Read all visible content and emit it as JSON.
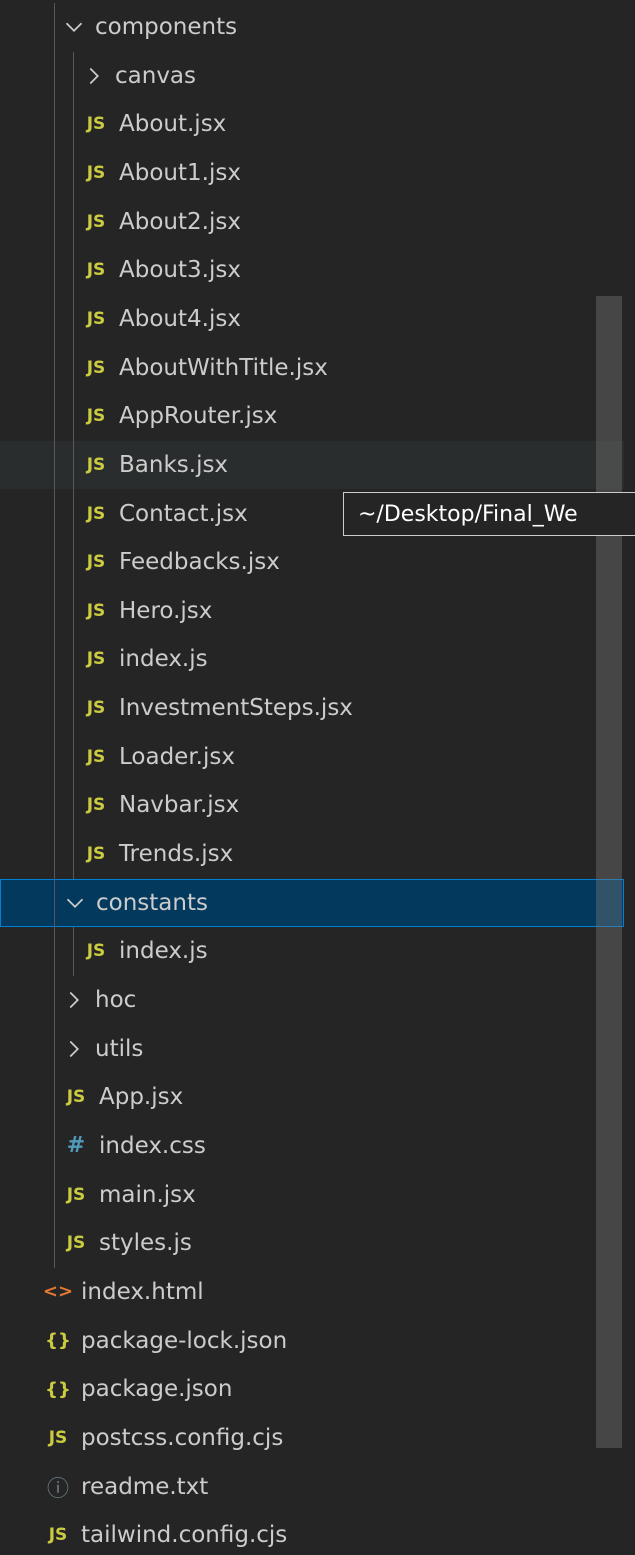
{
  "tooltip": {
    "text": "~/Desktop/Final_We"
  },
  "items": [
    {
      "label": "components",
      "kind": "folder-open",
      "depth": 1
    },
    {
      "label": "canvas",
      "kind": "folder-closed",
      "depth": 2
    },
    {
      "label": "About.jsx",
      "kind": "js",
      "depth": 2
    },
    {
      "label": "About1.jsx",
      "kind": "js",
      "depth": 2
    },
    {
      "label": "About2.jsx",
      "kind": "js",
      "depth": 2
    },
    {
      "label": "About3.jsx",
      "kind": "js",
      "depth": 2
    },
    {
      "label": "About4.jsx",
      "kind": "js",
      "depth": 2
    },
    {
      "label": "AboutWithTitle.jsx",
      "kind": "js",
      "depth": 2
    },
    {
      "label": "AppRouter.jsx",
      "kind": "js",
      "depth": 2
    },
    {
      "label": "Banks.jsx",
      "kind": "js",
      "depth": 2,
      "state": "hovered"
    },
    {
      "label": "Contact.jsx",
      "kind": "js",
      "depth": 2
    },
    {
      "label": "Feedbacks.jsx",
      "kind": "js",
      "depth": 2
    },
    {
      "label": "Hero.jsx",
      "kind": "js",
      "depth": 2
    },
    {
      "label": "index.js",
      "kind": "js",
      "depth": 2
    },
    {
      "label": "InvestmentSteps.jsx",
      "kind": "js",
      "depth": 2
    },
    {
      "label": "Loader.jsx",
      "kind": "js",
      "depth": 2
    },
    {
      "label": "Navbar.jsx",
      "kind": "js",
      "depth": 2
    },
    {
      "label": "Trends.jsx",
      "kind": "js",
      "depth": 2
    },
    {
      "label": "constants",
      "kind": "folder-open",
      "depth": 1,
      "state": "selected"
    },
    {
      "label": "index.js",
      "kind": "js",
      "depth": 2
    },
    {
      "label": "hoc",
      "kind": "folder-closed",
      "depth": 1
    },
    {
      "label": "utils",
      "kind": "folder-closed",
      "depth": 1
    },
    {
      "label": "App.jsx",
      "kind": "js",
      "depth": 1
    },
    {
      "label": "index.css",
      "kind": "css",
      "depth": 1
    },
    {
      "label": "main.jsx",
      "kind": "js",
      "depth": 1
    },
    {
      "label": "styles.js",
      "kind": "js",
      "depth": 1
    },
    {
      "label": "index.html",
      "kind": "html",
      "depth": 0
    },
    {
      "label": "package-lock.json",
      "kind": "json",
      "depth": 0
    },
    {
      "label": "package.json",
      "kind": "json",
      "depth": 0
    },
    {
      "label": "postcss.config.cjs",
      "kind": "js",
      "depth": 0
    },
    {
      "label": "readme.txt",
      "kind": "info",
      "depth": 0
    },
    {
      "label": "tailwind.config.cjs",
      "kind": "js",
      "depth": 0
    }
  ],
  "icons": {
    "js": {
      "glyph": "JS",
      "name": "js-file-icon",
      "color": "#cbcb41"
    },
    "css": {
      "glyph": "#",
      "name": "css-file-icon",
      "color": "#519aba"
    },
    "html": {
      "glyph": "<>",
      "name": "html-file-icon",
      "color": "#e37933"
    },
    "json": {
      "glyph": "{}",
      "name": "json-file-icon",
      "color": "#cbcb41"
    },
    "info": {
      "glyph": "ⓘ",
      "name": "info-file-icon",
      "color": "#6d8086"
    }
  },
  "colors": {
    "background": "#252526",
    "text": "#cccccc",
    "selection": "#04395e",
    "selection_border": "#007fd4",
    "hover": "#2a2d2e"
  }
}
